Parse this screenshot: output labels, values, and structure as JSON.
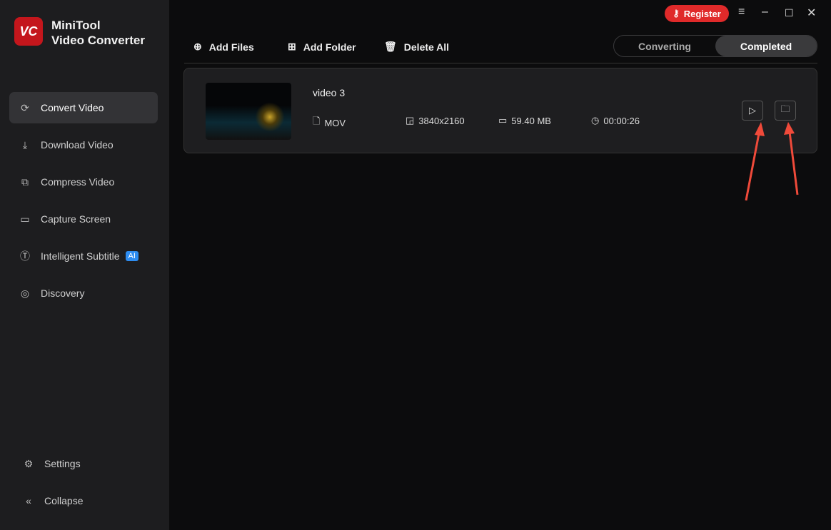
{
  "app": {
    "logo_text": "VC",
    "name_line1": "MiniTool",
    "name_line2": "Video Converter"
  },
  "sidebar": {
    "items": [
      {
        "label": "Convert Video"
      },
      {
        "label": "Download Video"
      },
      {
        "label": "Compress Video"
      },
      {
        "label": "Capture Screen"
      },
      {
        "label": "Intelligent Subtitle",
        "badge": "AI"
      },
      {
        "label": "Discovery"
      }
    ],
    "settings": "Settings",
    "collapse": "Collapse"
  },
  "titlebar": {
    "register": "Register"
  },
  "toolbar": {
    "add_files": "Add Files",
    "add_folder": "Add Folder",
    "delete_all": "Delete All"
  },
  "tabs": {
    "converting": "Converting",
    "completed": "Completed"
  },
  "file": {
    "name": "video 3",
    "format": "MOV",
    "resolution": "3840x2160",
    "size": "59.40 MB",
    "duration": "00:00:26"
  }
}
